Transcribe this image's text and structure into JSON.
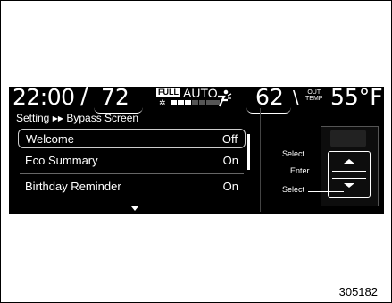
{
  "status_bar": {
    "clock": "22:00",
    "left_temp": "72",
    "full_badge": "FULL",
    "auto_label": "AUTO",
    "fan_level": 3,
    "fan_total": 7,
    "right_temp": "62",
    "out_temp_label_1": "OUT",
    "out_temp_label_2": "TEMP",
    "out_temp_value": "55°F"
  },
  "breadcrumb": {
    "parent": "Setting",
    "separator": "▶▶",
    "current": "Bypass Screen"
  },
  "menu": {
    "items": [
      {
        "label": "Welcome",
        "value": "Off",
        "selected": true
      },
      {
        "label": "Eco Summary",
        "value": "On",
        "selected": false
      },
      {
        "label": "Birthday Reminder",
        "value": "On",
        "selected": false
      }
    ]
  },
  "controls": {
    "select_up_label": "Select",
    "enter_label": "Enter",
    "select_down_label": "Select"
  },
  "icons": {
    "fan": "fan-icon",
    "airflow": "airflow-icon",
    "more_below": "chevron-down-icon"
  },
  "figure_number": "305182"
}
